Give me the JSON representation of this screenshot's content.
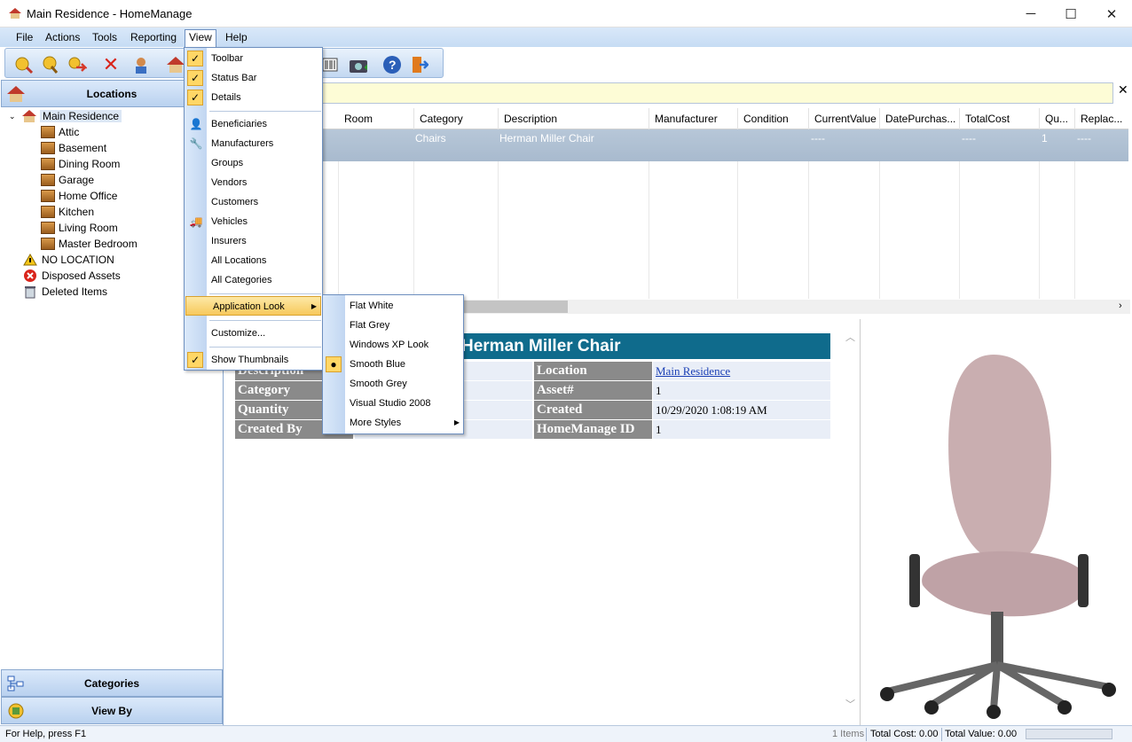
{
  "window": {
    "title": "Main Residence - HomeManage",
    "min": "─",
    "max": "☐",
    "close": "✕"
  },
  "menubar": [
    "File",
    "Actions",
    "Tools",
    "Reporting",
    "View",
    "Help"
  ],
  "nav": {
    "locations_label": "Locations",
    "categories_label": "Categories",
    "viewby_label": "View By",
    "tree": {
      "root": "Main Residence",
      "rooms": [
        "Attic",
        "Basement",
        "Dining Room",
        "Garage",
        "Home Office",
        "Kitchen",
        "Living Room",
        "Master Bedroom"
      ],
      "no_location": "NO LOCATION",
      "disposed": "Disposed Assets",
      "deleted": "Deleted Items"
    }
  },
  "grid": {
    "columns": [
      "Room",
      "Category",
      "Description",
      "Manufacturer",
      "Condition",
      "CurrentValue",
      "DatePurchas...",
      "TotalCost",
      "Qu...",
      "Replac..."
    ],
    "row": {
      "category": "Chairs",
      "description": "Herman Miller Chair",
      "current_value": "----",
      "total_cost": "----",
      "qty": "1",
      "replace": "----"
    }
  },
  "detail": {
    "title": "Herman Miller Chair",
    "labels": [
      "Description",
      "Category",
      "Quantity",
      "Created By"
    ],
    "right_labels": [
      "Location",
      "Asset#",
      "Created",
      "HomeManage ID"
    ],
    "right_values": [
      "Main Residence",
      "1",
      "10/29/2020 1:08:19 AM",
      "1"
    ]
  },
  "view_menu": {
    "items": [
      "Toolbar",
      "Status Bar",
      "Details",
      "Beneficiaries",
      "Manufacturers",
      "Groups",
      "Vendors",
      "Customers",
      "Vehicles",
      "Insurers",
      "All Locations",
      "All Categories",
      "Application Look",
      "Customize...",
      "Show Thumbnails"
    ]
  },
  "look_menu": {
    "items": [
      "Flat White",
      "Flat Grey",
      "Windows XP Look",
      "Smooth Blue",
      "Smooth Grey",
      "Visual Studio 2008",
      "More Styles"
    ],
    "selected": "Smooth Blue"
  },
  "status": {
    "help": "For Help, press F1",
    "items": "1 Items",
    "total_cost": "Total Cost: 0.00",
    "total_value": "Total Value: 0.00"
  },
  "colors": {
    "accent": "#0f6b8c",
    "menu_highlight": "#f7c95c",
    "chrome": "#c6dcf4"
  }
}
